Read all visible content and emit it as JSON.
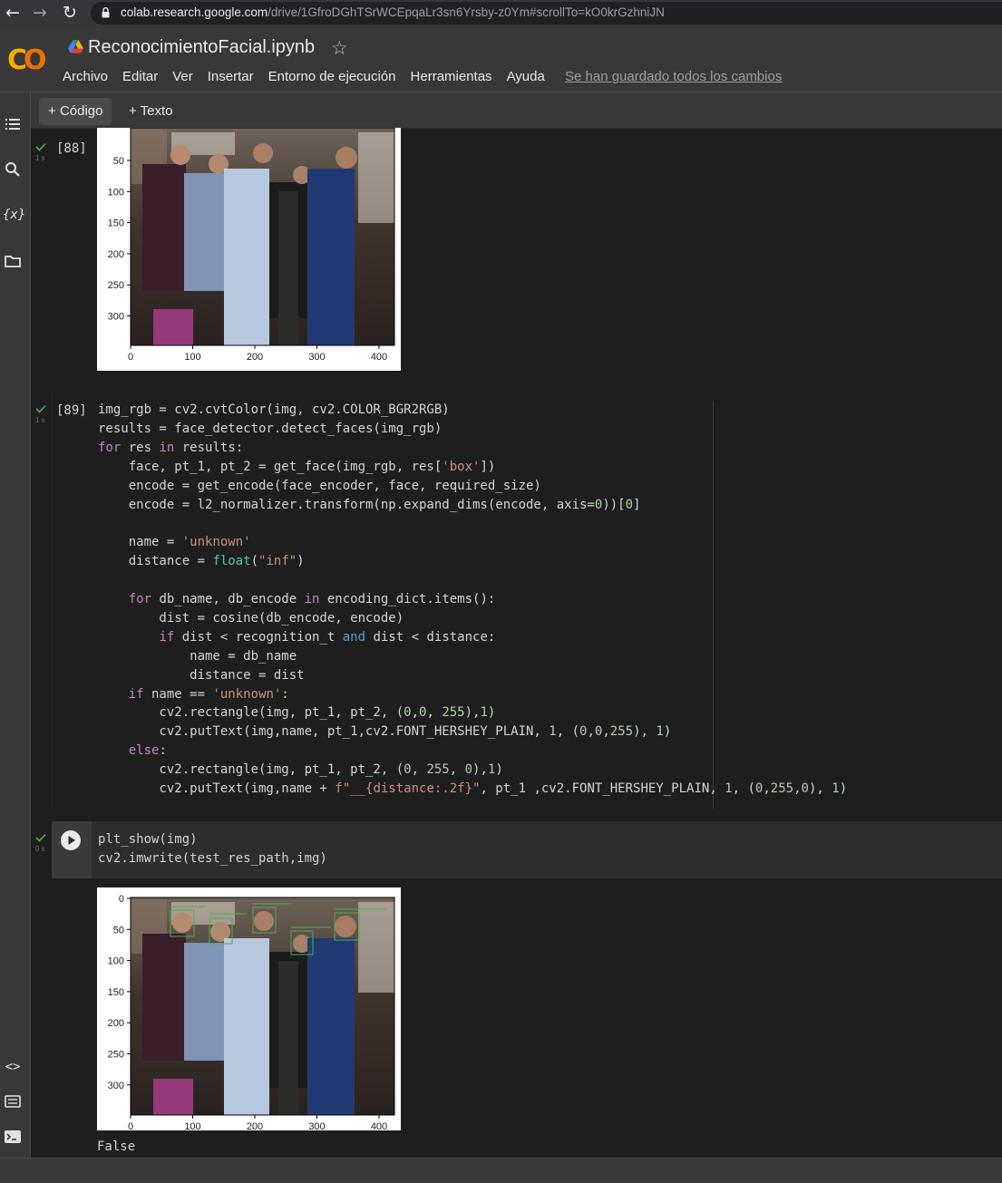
{
  "browser": {
    "url_host": "colab.research.google.com",
    "url_path": "/drive/1GfroDGhTSrWCEpqaLr3sn6Yrsby-z0Ym#scrollTo=kO0krGzhniJN"
  },
  "header": {
    "title": "ReconocimientoFacial.ipynb",
    "menu": [
      "Archivo",
      "Editar",
      "Ver",
      "Insertar",
      "Entorno de ejecución",
      "Herramientas",
      "Ayuda"
    ],
    "saved_status": "Se han guardado todos los cambios"
  },
  "toolbar": {
    "add_code": "+ Código",
    "add_text": "+ Texto"
  },
  "cells": {
    "c88": {
      "prompt": "[88]",
      "time": "1 s"
    },
    "c89": {
      "prompt": "[89]",
      "time": "1 s",
      "lines": [
        "img_rgb = cv2.cvtColor(img, cv2.COLOR_BGR2RGB)",
        "results = face_detector.detect_faces(img_rgb)",
        "for res in results:",
        "    face, pt_1, pt_2 = get_face(img_rgb, res['box'])",
        "    encode = get_encode(face_encoder, face, required_size)",
        "    encode = l2_normalizer.transform(np.expand_dims(encode, axis=0))[0]",
        "",
        "    name = 'unknown'",
        "    distance = float(\"inf\")",
        "",
        "    for db_name, db_encode in encoding_dict.items():",
        "        dist = cosine(db_encode, encode)",
        "        if dist < recognition_t and dist < distance:",
        "            name = db_name",
        "            distance = dist",
        "    if name == 'unknown':",
        "        cv2.rectangle(img, pt_1, pt_2, (0,0, 255),1)",
        "        cv2.putText(img,name, pt_1,cv2.FONT_HERSHEY_PLAIN, 1, (0,0,255), 1)",
        "    else:",
        "        cv2.rectangle(img, pt_1, pt_2, (0, 255, 0),1)",
        "        cv2.putText(img,name + f\"__{distance:.2f}\", pt_1 ,cv2.FONT_HERSHEY_PLAIN, 1, (0,255,0), 1)"
      ]
    },
    "c90": {
      "time": "0 s",
      "lines": [
        "plt_show(img)",
        "cv2.imwrite(test_res_path,img)"
      ],
      "output_text": "False"
    }
  },
  "plot1": {
    "y_ticks": [
      "50",
      "100",
      "150",
      "200",
      "250",
      "300"
    ],
    "x_ticks": [
      "0",
      "100",
      "200",
      "300",
      "400"
    ]
  },
  "plot2": {
    "y_ticks": [
      "0",
      "50",
      "100",
      "150",
      "200",
      "250",
      "300"
    ],
    "x_ticks": [
      "0",
      "100",
      "200",
      "300",
      "400"
    ]
  },
  "colors": {
    "accent": "#f9ab00",
    "success": "#4caf50"
  },
  "icons": [
    "back-arrow-icon",
    "forward-arrow-icon",
    "reload-icon",
    "lock-icon",
    "drive-icon",
    "star-icon",
    "toc-icon",
    "search-icon",
    "variables-icon",
    "files-icon",
    "code-snippets-icon",
    "command-palette-icon",
    "terminal-icon",
    "run-icon",
    "check-icon"
  ]
}
